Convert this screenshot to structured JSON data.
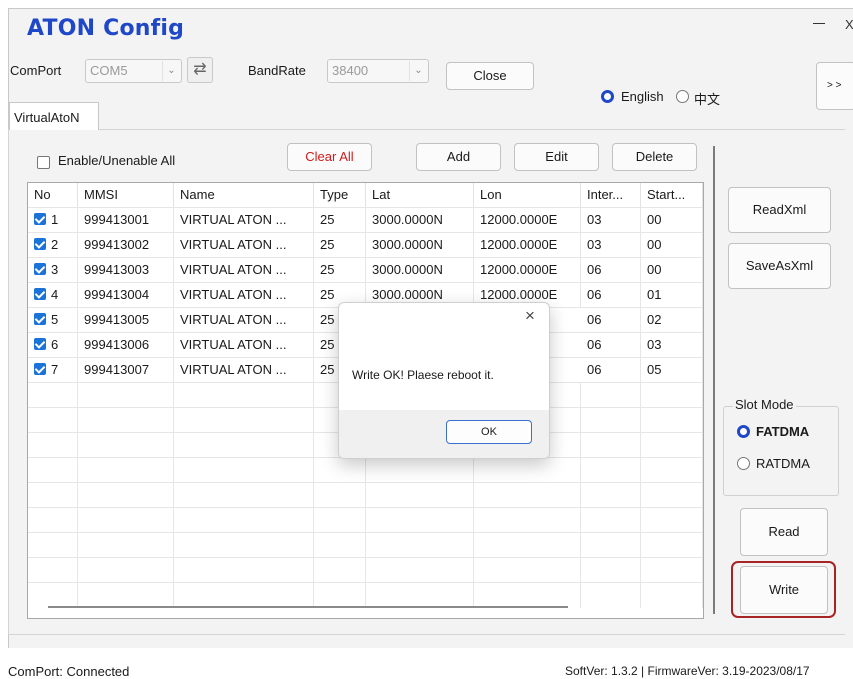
{
  "window": {
    "title": "ATON Config",
    "minimize": "—",
    "close": "X"
  },
  "toolbar": {
    "comport_label": "ComPort",
    "comport_value": "COM5",
    "baudrate_label": "BandRate",
    "baudrate_value": "38400",
    "close_button": "Close",
    "lang_english": "English",
    "lang_chinese": "中文",
    "expand_button": "> >"
  },
  "tabs": [
    {
      "label": "VirtualAtoN"
    }
  ],
  "actions": {
    "enable_all": "Enable/Unenable All",
    "clear_all": "Clear All",
    "add": "Add",
    "edit": "Edit",
    "delete": "Delete"
  },
  "table": {
    "columns": [
      "No",
      "MMSI",
      "Name",
      "Type",
      "Lat",
      "Lon",
      "Inter...",
      "Start..."
    ],
    "rows": [
      {
        "no": "1",
        "mmsi": "999413001",
        "name": "VIRTUAL ATON ...",
        "type": "25",
        "lat": "3000.0000N",
        "lon": "12000.0000E",
        "inter": "03",
        "start": "00"
      },
      {
        "no": "2",
        "mmsi": "999413002",
        "name": "VIRTUAL ATON ...",
        "type": "25",
        "lat": "3000.0000N",
        "lon": "12000.0000E",
        "inter": "03",
        "start": "00"
      },
      {
        "no": "3",
        "mmsi": "999413003",
        "name": "VIRTUAL ATON ...",
        "type": "25",
        "lat": "3000.0000N",
        "lon": "12000.0000E",
        "inter": "06",
        "start": "00"
      },
      {
        "no": "4",
        "mmsi": "999413004",
        "name": "VIRTUAL ATON ...",
        "type": "25",
        "lat": "3000.0000N",
        "lon": "12000.0000E",
        "inter": "06",
        "start": "01"
      },
      {
        "no": "5",
        "mmsi": "999413005",
        "name": "VIRTUAL ATON ...",
        "type": "25",
        "lat": "",
        "lon": "0E",
        "inter": "06",
        "start": "02"
      },
      {
        "no": "6",
        "mmsi": "999413006",
        "name": "VIRTUAL ATON ...",
        "type": "25",
        "lat": "",
        "lon": "0E",
        "inter": "06",
        "start": "03"
      },
      {
        "no": "7",
        "mmsi": "999413007",
        "name": "VIRTUAL ATON ...",
        "type": "25",
        "lat": "",
        "lon": "0E",
        "inter": "06",
        "start": "05"
      }
    ]
  },
  "side": {
    "read_xml": "ReadXml",
    "save_as_xml": "SaveAsXml",
    "slot_mode_title": "Slot Mode",
    "fatdma": "FATDMA",
    "ratdma": "RATDMA",
    "read": "Read",
    "write": "Write"
  },
  "status": {
    "left": "ComPort: Connected",
    "right": "SoftVer: 1.3.2 | FirmwareVer: 3.19-2023/08/17"
  },
  "dialog": {
    "message": "Write OK! Plaese reboot it.",
    "ok": "OK",
    "close": "×"
  },
  "colors": {
    "accent": "#1f48c9",
    "danger": "#d11b1b",
    "check": "#1a73d8",
    "highlight": "#a82424"
  }
}
